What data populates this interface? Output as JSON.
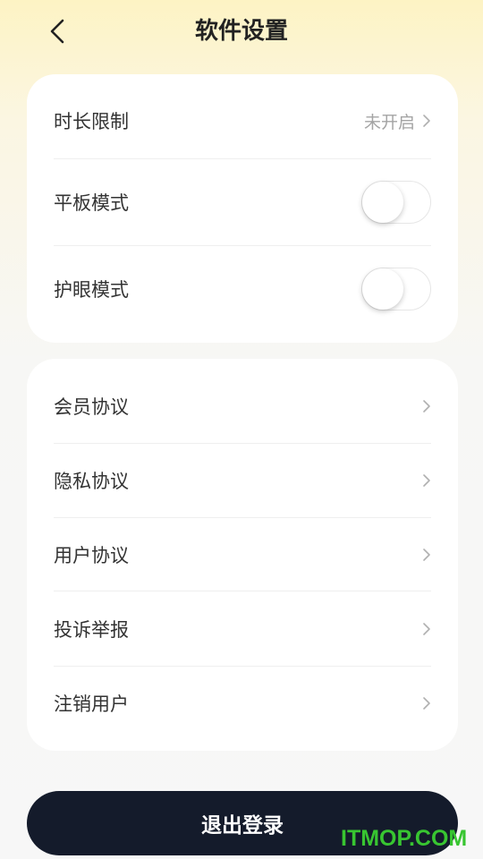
{
  "header": {
    "title": "软件设置"
  },
  "settings": {
    "time_limit": {
      "label": "时长限制",
      "value": "未开启"
    },
    "tablet_mode": {
      "label": "平板模式",
      "enabled": false
    },
    "eye_care_mode": {
      "label": "护眼模式",
      "enabled": false
    }
  },
  "links": [
    {
      "label": "会员协议"
    },
    {
      "label": "隐私协议"
    },
    {
      "label": "用户协议"
    },
    {
      "label": "投诉举报"
    },
    {
      "label": "注销用户"
    }
  ],
  "logout": {
    "label": "退出登录"
  },
  "watermark": "ITMOP.COM",
  "colors": {
    "header_gradient_top": "#fdf3c4",
    "page_background": "#f7f7f7",
    "logout_button": "#141b2b",
    "watermark": "#38c531"
  }
}
